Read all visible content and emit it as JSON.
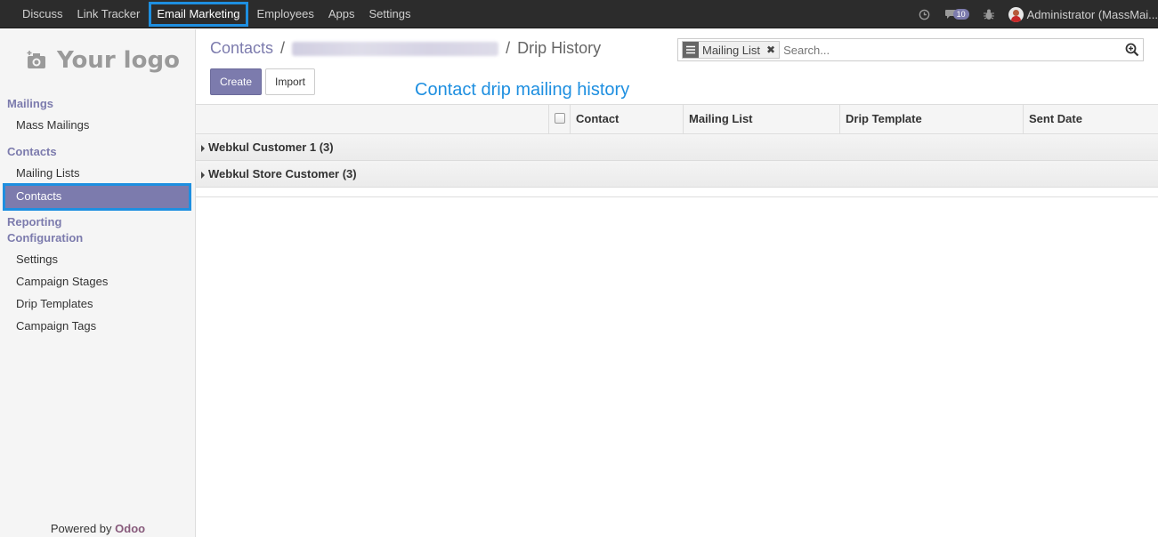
{
  "topbar": {
    "menu": [
      "Discuss",
      "Link Tracker",
      "Email Marketing",
      "Employees",
      "Apps",
      "Settings"
    ],
    "active_index": 2,
    "messages_count": "10",
    "user_label": "Administrator (MassMai..."
  },
  "sidebar": {
    "logo_text": "Your logo",
    "mailings_heading": "Mailings",
    "mass_mailings": "Mass Mailings",
    "contacts_heading": "Contacts",
    "mailing_lists": "Mailing Lists",
    "contacts_active": "Contacts",
    "reporting_heading": "Reporting",
    "configuration_heading": "Configuration",
    "settings": "Settings",
    "campaign_stages": "Campaign Stages",
    "drip_templates": "Drip Templates",
    "campaign_tags": "Campaign Tags",
    "powered_by": "Powered by",
    "odoo": "Odoo"
  },
  "breadcrumb": {
    "root": "Contacts",
    "sep": "/",
    "current": "Drip History"
  },
  "search": {
    "facet_label": "Mailing List",
    "placeholder": "Search..."
  },
  "buttons": {
    "create": "Create",
    "import": "Import"
  },
  "annotation": "Contact drip mailing history",
  "table": {
    "columns": [
      "Contact",
      "Mailing List",
      "Drip Template",
      "Sent Date"
    ],
    "groups": [
      "Webkul Customer 1 (3)",
      "Webkul Store Customer (3)"
    ]
  },
  "colors": {
    "accent": "#7c7bad",
    "highlight": "#1e8fe0",
    "topbar": "#2c2c2c"
  }
}
